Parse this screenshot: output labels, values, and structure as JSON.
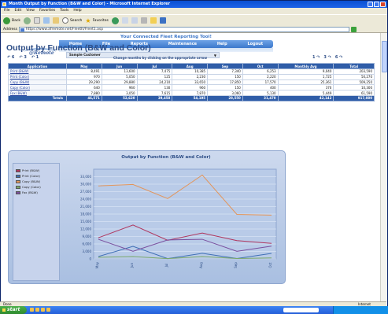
{
  "window": {
    "title": "Month Output by Function (B&W and Color) - Microsoft Internet Explorer"
  },
  "menu": [
    "File",
    "Edit",
    "View",
    "Favorites",
    "Tools",
    "Help"
  ],
  "toolbar": {
    "back": "Back",
    "search": "Search",
    "favorites": "Favorites"
  },
  "address": {
    "label": "Address",
    "url": "https://www.afremote.net/FleetIt/Fleet1.asp"
  },
  "site": {
    "tool_title": "Your Connected Fleet Reporting Tool!",
    "nav": [
      "Home",
      "File",
      "Reports",
      "Maintenance",
      "Help",
      "Logout"
    ],
    "logo": "@Remote",
    "customer": "Sample Customer"
  },
  "report": {
    "title": "Output by Function (B&W and Color)",
    "nav_left": [
      "↶ 6",
      "↶ 3",
      "↶ 1"
    ],
    "hint": "Change months by clicking on the appropriate arrow",
    "nav_right": [
      "1 ↷",
      "3 ↷",
      "6 ↷"
    ],
    "columns": [
      "Application",
      "May",
      "Jun",
      "Jul",
      "Aug",
      "Sep",
      "Oct",
      "Monthly Avg",
      "Total"
    ],
    "rows": [
      [
        "Print (B&W)",
        "8,491",
        "13,600",
        "7,475",
        "10,385",
        "7,340",
        "6,253",
        "9,040",
        "203,590"
      ],
      [
        "Print (Color)",
        "970",
        "5,050",
        "125",
        "2,230",
        "150",
        "2,220",
        "1,725",
        "50,270"
      ],
      [
        "Copy (B&W)",
        "29,290",
        "29,880",
        "24,210",
        "33,650",
        "17,850",
        "17,570",
        "25,361",
        "509,250"
      ],
      [
        "Copy (Color)",
        "640",
        "960",
        "130",
        "960",
        "150",
        "400",
        "370",
        "10,300"
      ],
      [
        "Fax (B&W)",
        "7,880",
        "3,050",
        "7,615",
        "7,870",
        "3,060",
        "5,130",
        "5,449",
        "61,590"
      ]
    ],
    "totals": [
      "Totals",
      "46,571",
      "52,620",
      "39,458",
      "54,195",
      "28,550",
      "31,470",
      "42,142",
      "917,080"
    ]
  },
  "chart_data": {
    "type": "line",
    "title": "Output by Function (B&W and Color)",
    "categories": [
      "May",
      "Jun",
      "Jul",
      "Aug",
      "Sep",
      "Oct"
    ],
    "ylim": [
      0,
      36000
    ],
    "yticks": [
      "0",
      "3,000",
      "6,000",
      "9,000",
      "12,000",
      "15,000",
      "18,000",
      "21,000",
      "24,000",
      "27,000",
      "30,000",
      "33,000"
    ],
    "series": [
      {
        "name": "Print (B&W)",
        "color": "#b0365e",
        "values": [
          8491,
          13600,
          7475,
          10385,
          7340,
          6253
        ]
      },
      {
        "name": "Print (Color)",
        "color": "#3f6fb5",
        "values": [
          970,
          5050,
          125,
          2230,
          150,
          2220
        ]
      },
      {
        "name": "Copy (B&W)",
        "color": "#e3955a",
        "values": [
          29290,
          29880,
          24210,
          33650,
          17850,
          17570
        ]
      },
      {
        "name": "Copy (Color)",
        "color": "#7aa86a",
        "values": [
          640,
          960,
          130,
          960,
          150,
          400
        ]
      },
      {
        "name": "Fax (B&W)",
        "color": "#7a4f9e",
        "values": [
          7880,
          3050,
          7615,
          7870,
          3060,
          5130
        ]
      }
    ],
    "grid": true,
    "legend": "left"
  },
  "status": {
    "left": "Done",
    "zone": "Internet"
  },
  "taskbar": {
    "start": "start"
  }
}
